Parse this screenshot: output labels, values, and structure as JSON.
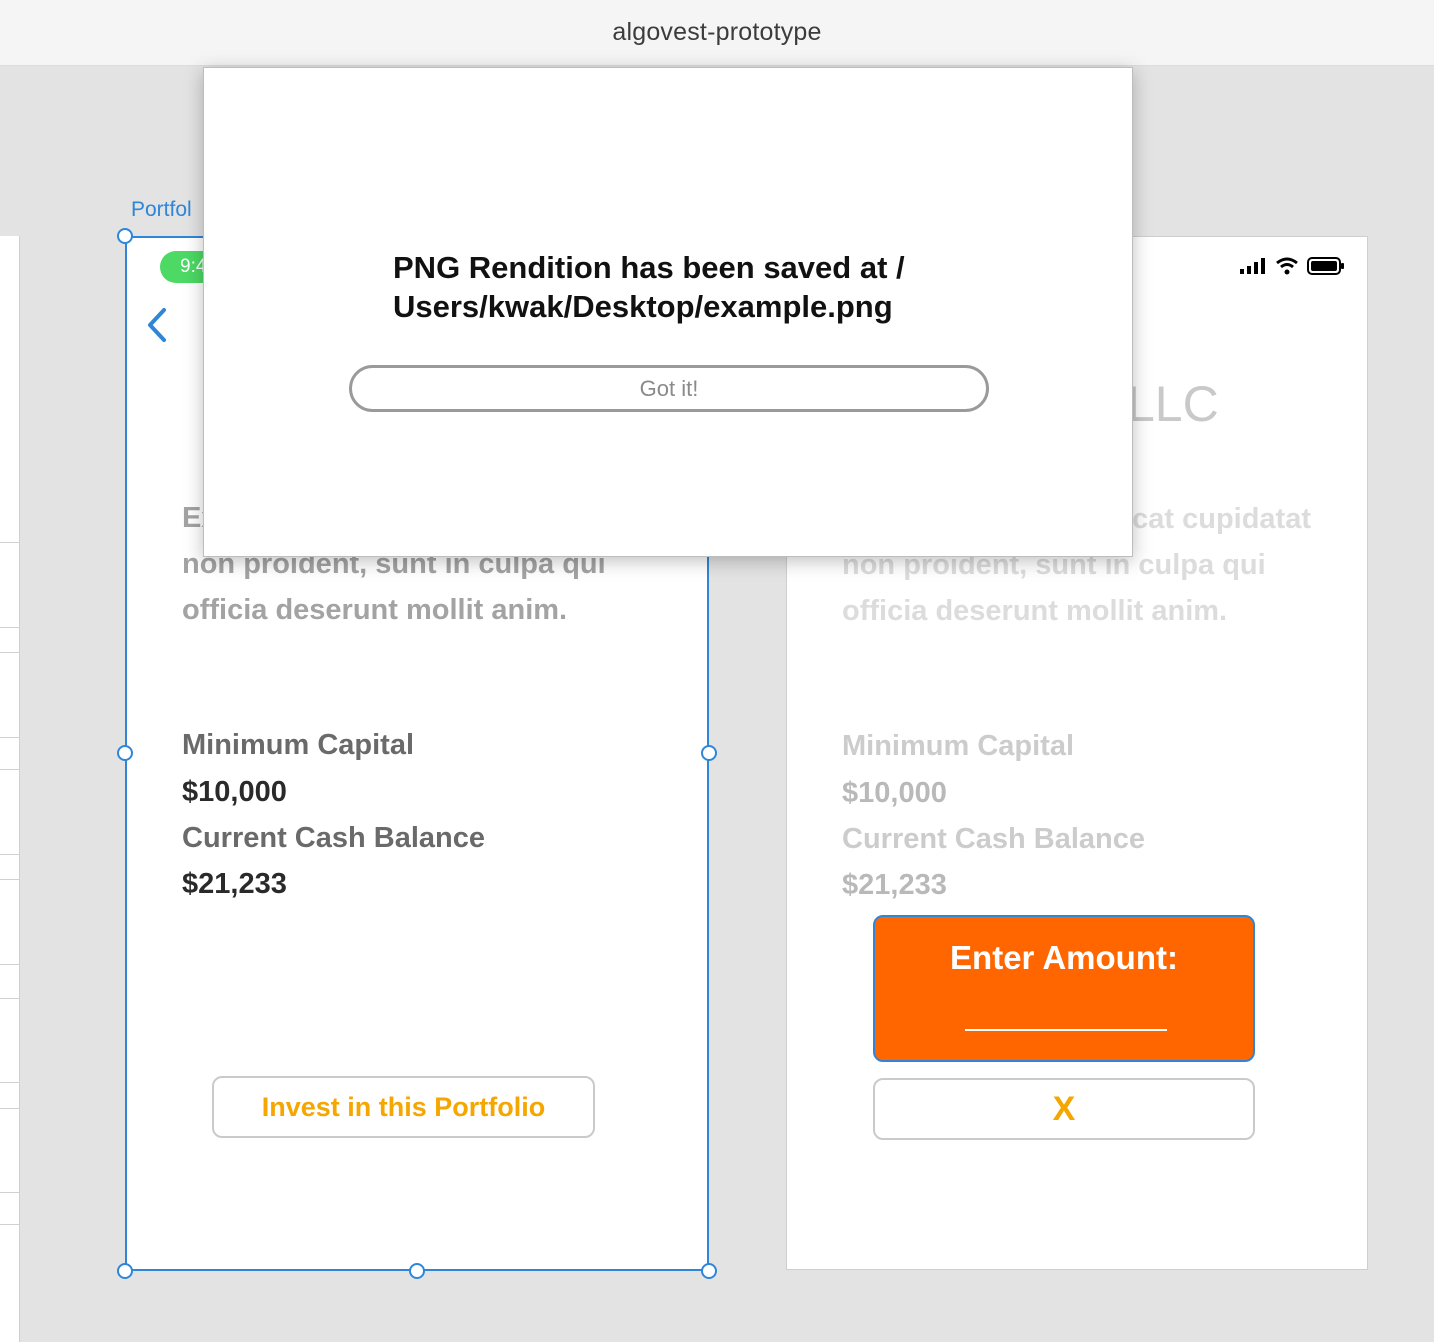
{
  "window": {
    "title": "algovest-prototype"
  },
  "canvas": {
    "artboard_label": "Portfol",
    "artboard1": {
      "time": "9:4",
      "description": "Excepteur sint occaecat cupidatat non proident, sunt in culpa qui officia deserunt mollit anim.",
      "min_capital_label": "Minimum Capital",
      "min_capital_value": "$10,000",
      "cash_balance_label": "Current Cash Balance",
      "cash_balance_value": "$21,233",
      "invest_button": "Invest in this Portfolio"
    },
    "artboard2": {
      "title_fragment": "LLC",
      "description": "Excepteur sint occaecat cupidatat non proident, sunt in culpa qui officia deserunt mollit anim.",
      "min_capital_label": "Minimum Capital",
      "min_capital_value": "$10,000",
      "cash_balance_label": "Current Cash Balance",
      "cash_balance_value": "$21,233",
      "enter_amount_label": "Enter Amount:",
      "close_button": "X"
    }
  },
  "modal": {
    "message": "PNG Rendition has been saved at /\nUsers/kwak/Desktop/example.png",
    "button": "Got it!"
  },
  "colors": {
    "selection": "#2f86d8",
    "accent_orange": "#ff6600",
    "button_text": "#f5a600",
    "status_green": "#4cd964"
  }
}
